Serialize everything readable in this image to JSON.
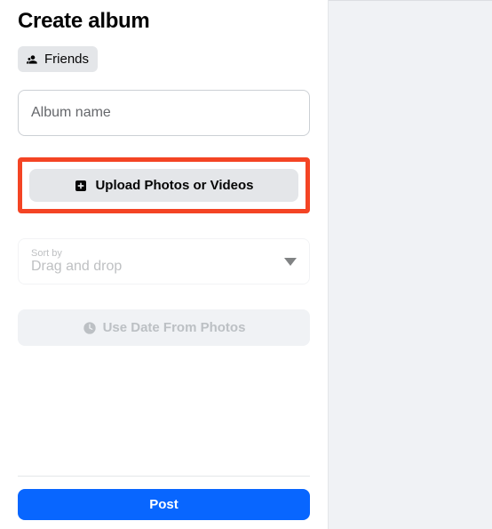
{
  "title": "Create album",
  "privacy": {
    "label": "Friends"
  },
  "album_name": {
    "value": "",
    "placeholder": "Album name"
  },
  "upload_label": "Upload Photos or Videos",
  "sort": {
    "label": "Sort by",
    "value": "Drag and drop"
  },
  "date_button_label": "Use Date From Photos",
  "post_label": "Post",
  "colors": {
    "primary": "#0866ff",
    "highlight": "#f44424"
  }
}
